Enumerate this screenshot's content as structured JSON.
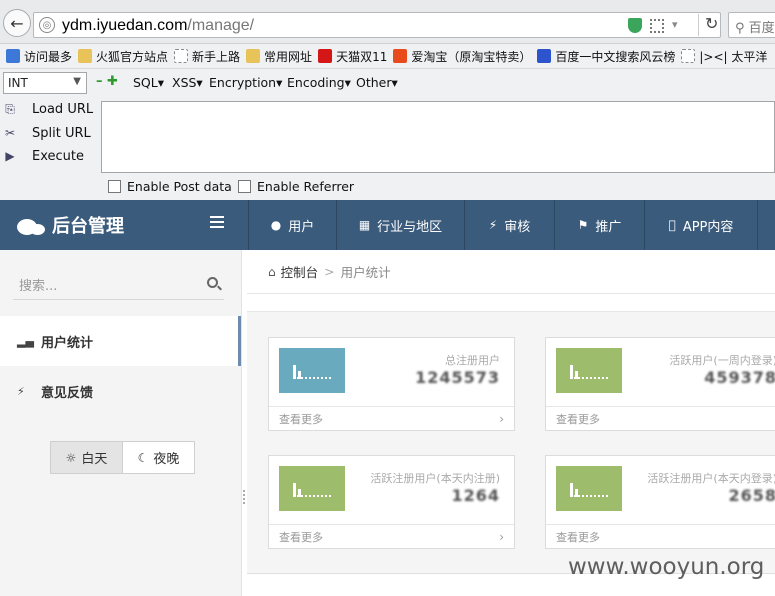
{
  "browser": {
    "url_domain": "ydm.iyuedan.com",
    "url_path": "/manage/",
    "search_placeholder": "百度"
  },
  "bookmarks": [
    {
      "label": "访问最多",
      "icon": "star-icon"
    },
    {
      "label": "火狐官方站点",
      "icon": "folder-icon"
    },
    {
      "label": "新手上路",
      "icon": "page-icon"
    },
    {
      "label": "常用网址",
      "icon": "folder-icon"
    },
    {
      "label": "天猫双11",
      "icon": "tmall-icon"
    },
    {
      "label": "爱淘宝（原淘宝特卖）",
      "icon": "taobao-icon"
    },
    {
      "label": "百度一中文搜索风云榜",
      "icon": "baidu-icon"
    },
    {
      "label": "|><| 太平洋",
      "icon": "page-icon"
    }
  ],
  "hackbar": {
    "select_value": "INT",
    "menus": [
      "SQL▾",
      "XSS▾",
      "Encryption▾",
      "Encoding▾",
      "Other▾"
    ],
    "actions": [
      "Load URL",
      "Split URL",
      "Execute"
    ],
    "checkboxes": [
      "Enable Post data",
      "Enable Referrer"
    ]
  },
  "admin": {
    "title": "后台管理",
    "nav": [
      {
        "label": "用户",
        "icon": "user-icon"
      },
      {
        "label": "行业与地区",
        "icon": "grid-icon"
      },
      {
        "label": "审核",
        "icon": "bolt-icon"
      },
      {
        "label": "推广",
        "icon": "megaphone-icon"
      },
      {
        "label": "APP内容",
        "icon": "apple-icon"
      }
    ]
  },
  "sidebar": {
    "search_placeholder": "搜索...",
    "items": [
      {
        "label": "用户统计",
        "icon": "bar-chart-icon",
        "active": true
      },
      {
        "label": "意见反馈",
        "icon": "bolt-icon",
        "active": false
      }
    ],
    "theme": {
      "day": "白天",
      "night": "夜晚",
      "selected": "day"
    }
  },
  "breadcrumb": {
    "home": "控制台",
    "current": "用户统计"
  },
  "cards": [
    {
      "label": "总注册用户",
      "value": "1245573",
      "more": "查看更多",
      "color": "#6aaabf"
    },
    {
      "label": "活跃用户(一周内登录)",
      "value": "459378",
      "more": "查看更多",
      "color": "#9dbc6c"
    },
    {
      "label": "活跃注册用户(本天内注册)",
      "value": "1264",
      "more": "查看更多",
      "color": "#9dbc6c"
    },
    {
      "label": "活跃注册用户(本天内登录)",
      "value": "2658",
      "more": "查看更多",
      "color": "#9dbc6c"
    }
  ],
  "watermark": "www.wooyun.org"
}
